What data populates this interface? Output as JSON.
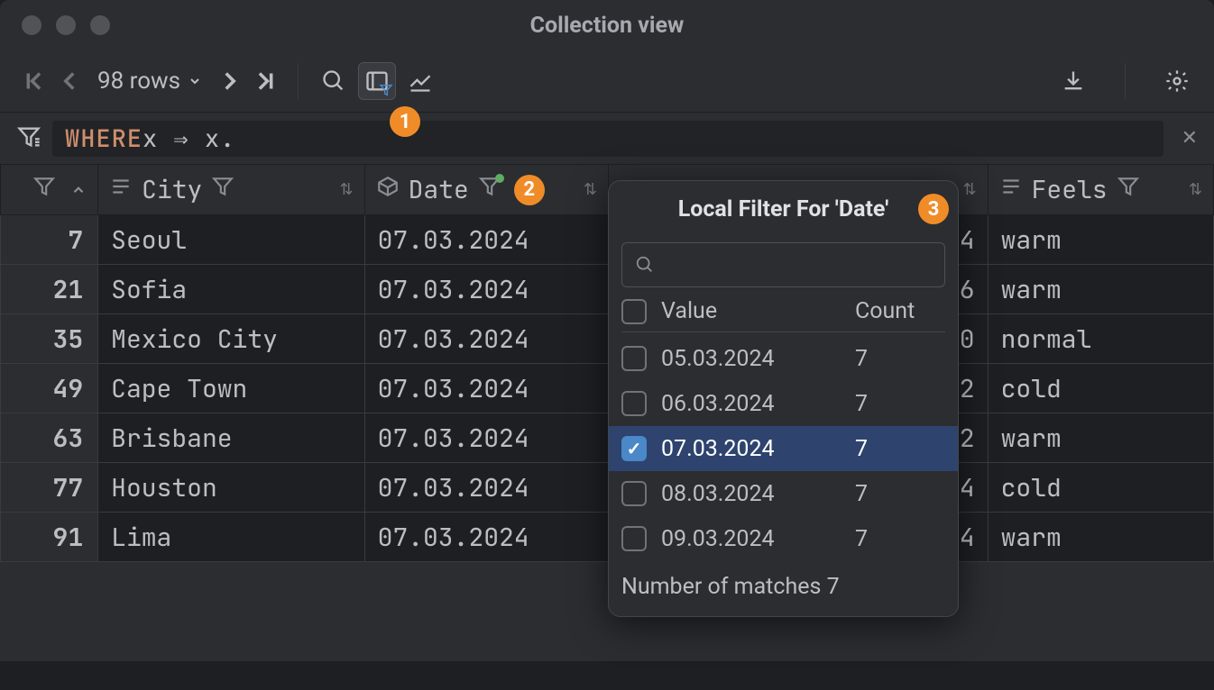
{
  "window": {
    "title": "Collection view"
  },
  "toolbar": {
    "row_count": "98 rows"
  },
  "callouts": {
    "one": "1",
    "two": "2",
    "three": "3"
  },
  "filter": {
    "where": "WHERE",
    "expr": " x ⇒ x."
  },
  "columns": {
    "city": "City",
    "date": "Date",
    "feels": "Feels"
  },
  "rows": [
    {
      "n": "7",
      "city": "Seoul",
      "date": "07.03.2024",
      "t": "4",
      "feels": "warm"
    },
    {
      "n": "21",
      "city": "Sofia",
      "date": "07.03.2024",
      "t": "6",
      "feels": "warm"
    },
    {
      "n": "35",
      "city": "Mexico City",
      "date": "07.03.2024",
      "t": "0",
      "feels": "normal"
    },
    {
      "n": "49",
      "city": "Cape Town",
      "date": "07.03.2024",
      "t": "2",
      "feels": "cold"
    },
    {
      "n": "63",
      "city": "Brisbane",
      "date": "07.03.2024",
      "t": "2",
      "feels": "warm"
    },
    {
      "n": "77",
      "city": "Houston",
      "date": "07.03.2024",
      "t": "4",
      "feels": "cold"
    },
    {
      "n": "91",
      "city": "Lima",
      "date": "07.03.2024",
      "t": "4",
      "feels": "warm"
    }
  ],
  "popup": {
    "title": "Local Filter For 'Date'",
    "value_header": "Value",
    "count_header": "Count",
    "items": [
      {
        "value": "05.03.2024",
        "count": "7",
        "checked": false
      },
      {
        "value": "06.03.2024",
        "count": "7",
        "checked": false
      },
      {
        "value": "07.03.2024",
        "count": "7",
        "checked": true
      },
      {
        "value": "08.03.2024",
        "count": "7",
        "checked": false
      },
      {
        "value": "09.03.2024",
        "count": "7",
        "checked": false
      }
    ],
    "footer": "Number of matches 7"
  }
}
